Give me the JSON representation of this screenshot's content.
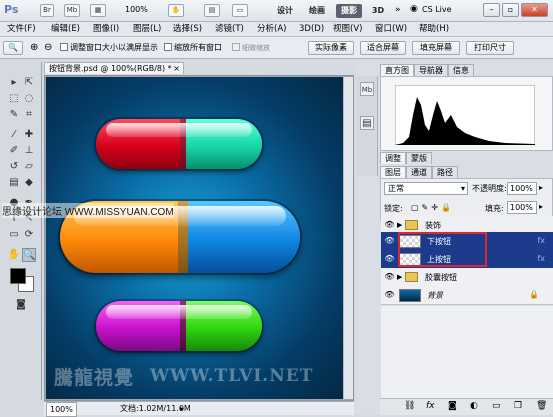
{
  "appbar": {
    "buttons": [
      "Br",
      "Mb"
    ],
    "zoom": "100%",
    "workspaces": [
      "设计",
      "绘画",
      "摄影",
      "3D"
    ],
    "active_workspace": "摄影",
    "cs_live": "CS Live"
  },
  "menu": [
    "文件(F)",
    "编辑(E)",
    "图像(I)",
    "图层(L)",
    "选择(S)",
    "滤镜(T)",
    "分析(A)",
    "3D(D)",
    "视图(V)",
    "窗口(W)",
    "帮助(H)"
  ],
  "options": {
    "resize_windows": "调整窗口大小以满屏显示",
    "zoom_all": "缩放所有窗口",
    "scrubby_zoom": "细微缩放",
    "actual_pixels": "实际像素",
    "fit_screen": "适合屏幕",
    "fill_screen": "填充屏幕",
    "print_size": "打印尺寸"
  },
  "document": {
    "tab_title": "按钮背景.psd @ 100%(RGB/8) *",
    "zoom": "100%",
    "doc_size": "文档:1.02M/11.0M",
    "watermark_cn": "騰龍視覺",
    "watermark_url": "WWW.TLVI.NET",
    "site_watermark": "思缘设计论坛  WWW.MISSYUAN.COM"
  },
  "panels": {
    "top_tabs": [
      "直方图",
      "导航器",
      "信息"
    ],
    "active_top_tab": "直方图",
    "mid_tabs": [
      "调整",
      "蒙版"
    ],
    "layer_tabs": [
      "图层",
      "通道",
      "路径"
    ],
    "blend_mode": "正常",
    "opacity_label": "不透明度:",
    "opacity": "100%",
    "lock_label": "锁定:",
    "fill_label": "填充:",
    "fill": "100%",
    "layers": [
      {
        "name": "装饰",
        "type": "group"
      },
      {
        "name": "下按钮",
        "type": "layer",
        "selected": true
      },
      {
        "name": "上按钮",
        "type": "layer",
        "selected": true
      },
      {
        "name": "胶囊按钮",
        "type": "group"
      },
      {
        "name": "背景",
        "type": "background"
      }
    ]
  },
  "colors": {
    "selection": "#1c3b8c",
    "highlight": "#e0272b"
  }
}
